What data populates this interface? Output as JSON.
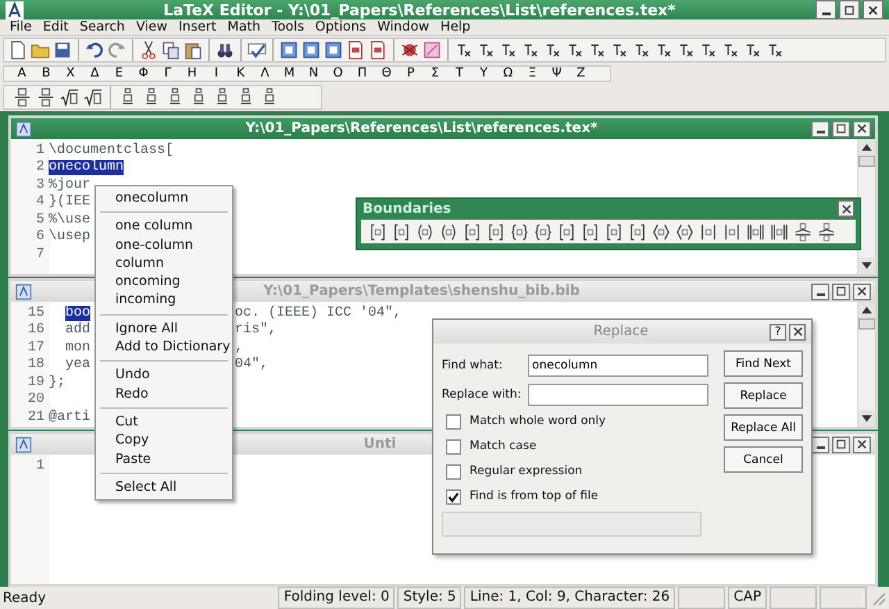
{
  "window": {
    "title": "LaTeX Editor - Y:\\01_Papers\\References\\List\\references.tex*"
  },
  "menu": [
    "File",
    "Edit",
    "Search",
    "View",
    "Insert",
    "Math",
    "Tools",
    "Options",
    "Window",
    "Help"
  ],
  "greek_letters": [
    "Α",
    "Β",
    "Χ",
    "Δ",
    "Ε",
    "Φ",
    "Γ",
    "Η",
    "Ι",
    "Κ",
    "Λ",
    "Μ",
    "Ν",
    "Ο",
    "Π",
    "Θ",
    "Ρ",
    "Σ",
    "Τ",
    "Υ",
    "Ω",
    "Ξ",
    "Ψ",
    "Ζ"
  ],
  "documents": [
    {
      "title": "Y:\\01_Papers\\References\\List\\references.tex*",
      "active": true,
      "lines": [
        {
          "number": "1",
          "text": "\\documentclass["
        },
        {
          "number": "2",
          "selected_text": "onecolumn"
        },
        {
          "number": "3",
          "text": "%jour"
        },
        {
          "number": "4",
          "text": "}(IEE"
        },
        {
          "number": "5",
          "text": "%\\use"
        },
        {
          "number": "6",
          "text": "\\usep"
        },
        {
          "number": "7"
        }
      ]
    },
    {
      "title": "Y:\\01_Papers\\Templates\\shenshu_bib.bib",
      "active": false,
      "lines": [
        {
          "number": "15",
          "indented": true,
          "selected_text": "boo",
          "after": "oc. (IEEE) ICC '04\","
        },
        {
          "number": "16",
          "indented": true,
          "text": "add",
          "after": "ris\","
        },
        {
          "number": "17",
          "indented": true,
          "text": "mon",
          "after": ","
        },
        {
          "number": "18",
          "indented": true,
          "text": "yea",
          "after": "04\","
        },
        {
          "number": "19",
          "text": "};"
        },
        {
          "number": "20"
        },
        {
          "number": "21",
          "text": "@arti"
        }
      ]
    },
    {
      "title": "Unti",
      "active": false,
      "lines": [
        {
          "number": "1"
        }
      ]
    }
  ],
  "boundaries": {
    "title": "Boundaries"
  },
  "context_menu": {
    "groups": [
      [
        "onecolumn"
      ],
      [
        "one column",
        "one-column",
        "column",
        "oncoming",
        "incoming"
      ],
      [
        "Ignore All",
        "Add to Dictionary"
      ],
      [
        "Undo",
        "Redo"
      ],
      [
        "Cut",
        "Copy",
        "Paste"
      ],
      [
        "Select All"
      ]
    ]
  },
  "replace_dialog": {
    "title": "Replace",
    "help": "?",
    "fields": [
      {
        "label": "Find what:",
        "value": "onecolumn"
      },
      {
        "label": "Replace with:"
      }
    ],
    "options": [
      {
        "label": "Match whole word only",
        "checked": false
      },
      {
        "label": "Match case",
        "checked": false
      },
      {
        "label": "Regular expression",
        "checked": false
      },
      {
        "label": "Find is from top of file",
        "checked": true
      }
    ],
    "buttons": [
      "Find Next",
      "Replace",
      "Replace All",
      "Cancel"
    ]
  },
  "status_bar": {
    "message": "Ready",
    "panels": [
      "Folding level: 0",
      "Style: 5",
      "Line: 1, Col: 9, Character: 26",
      "CAP"
    ]
  }
}
